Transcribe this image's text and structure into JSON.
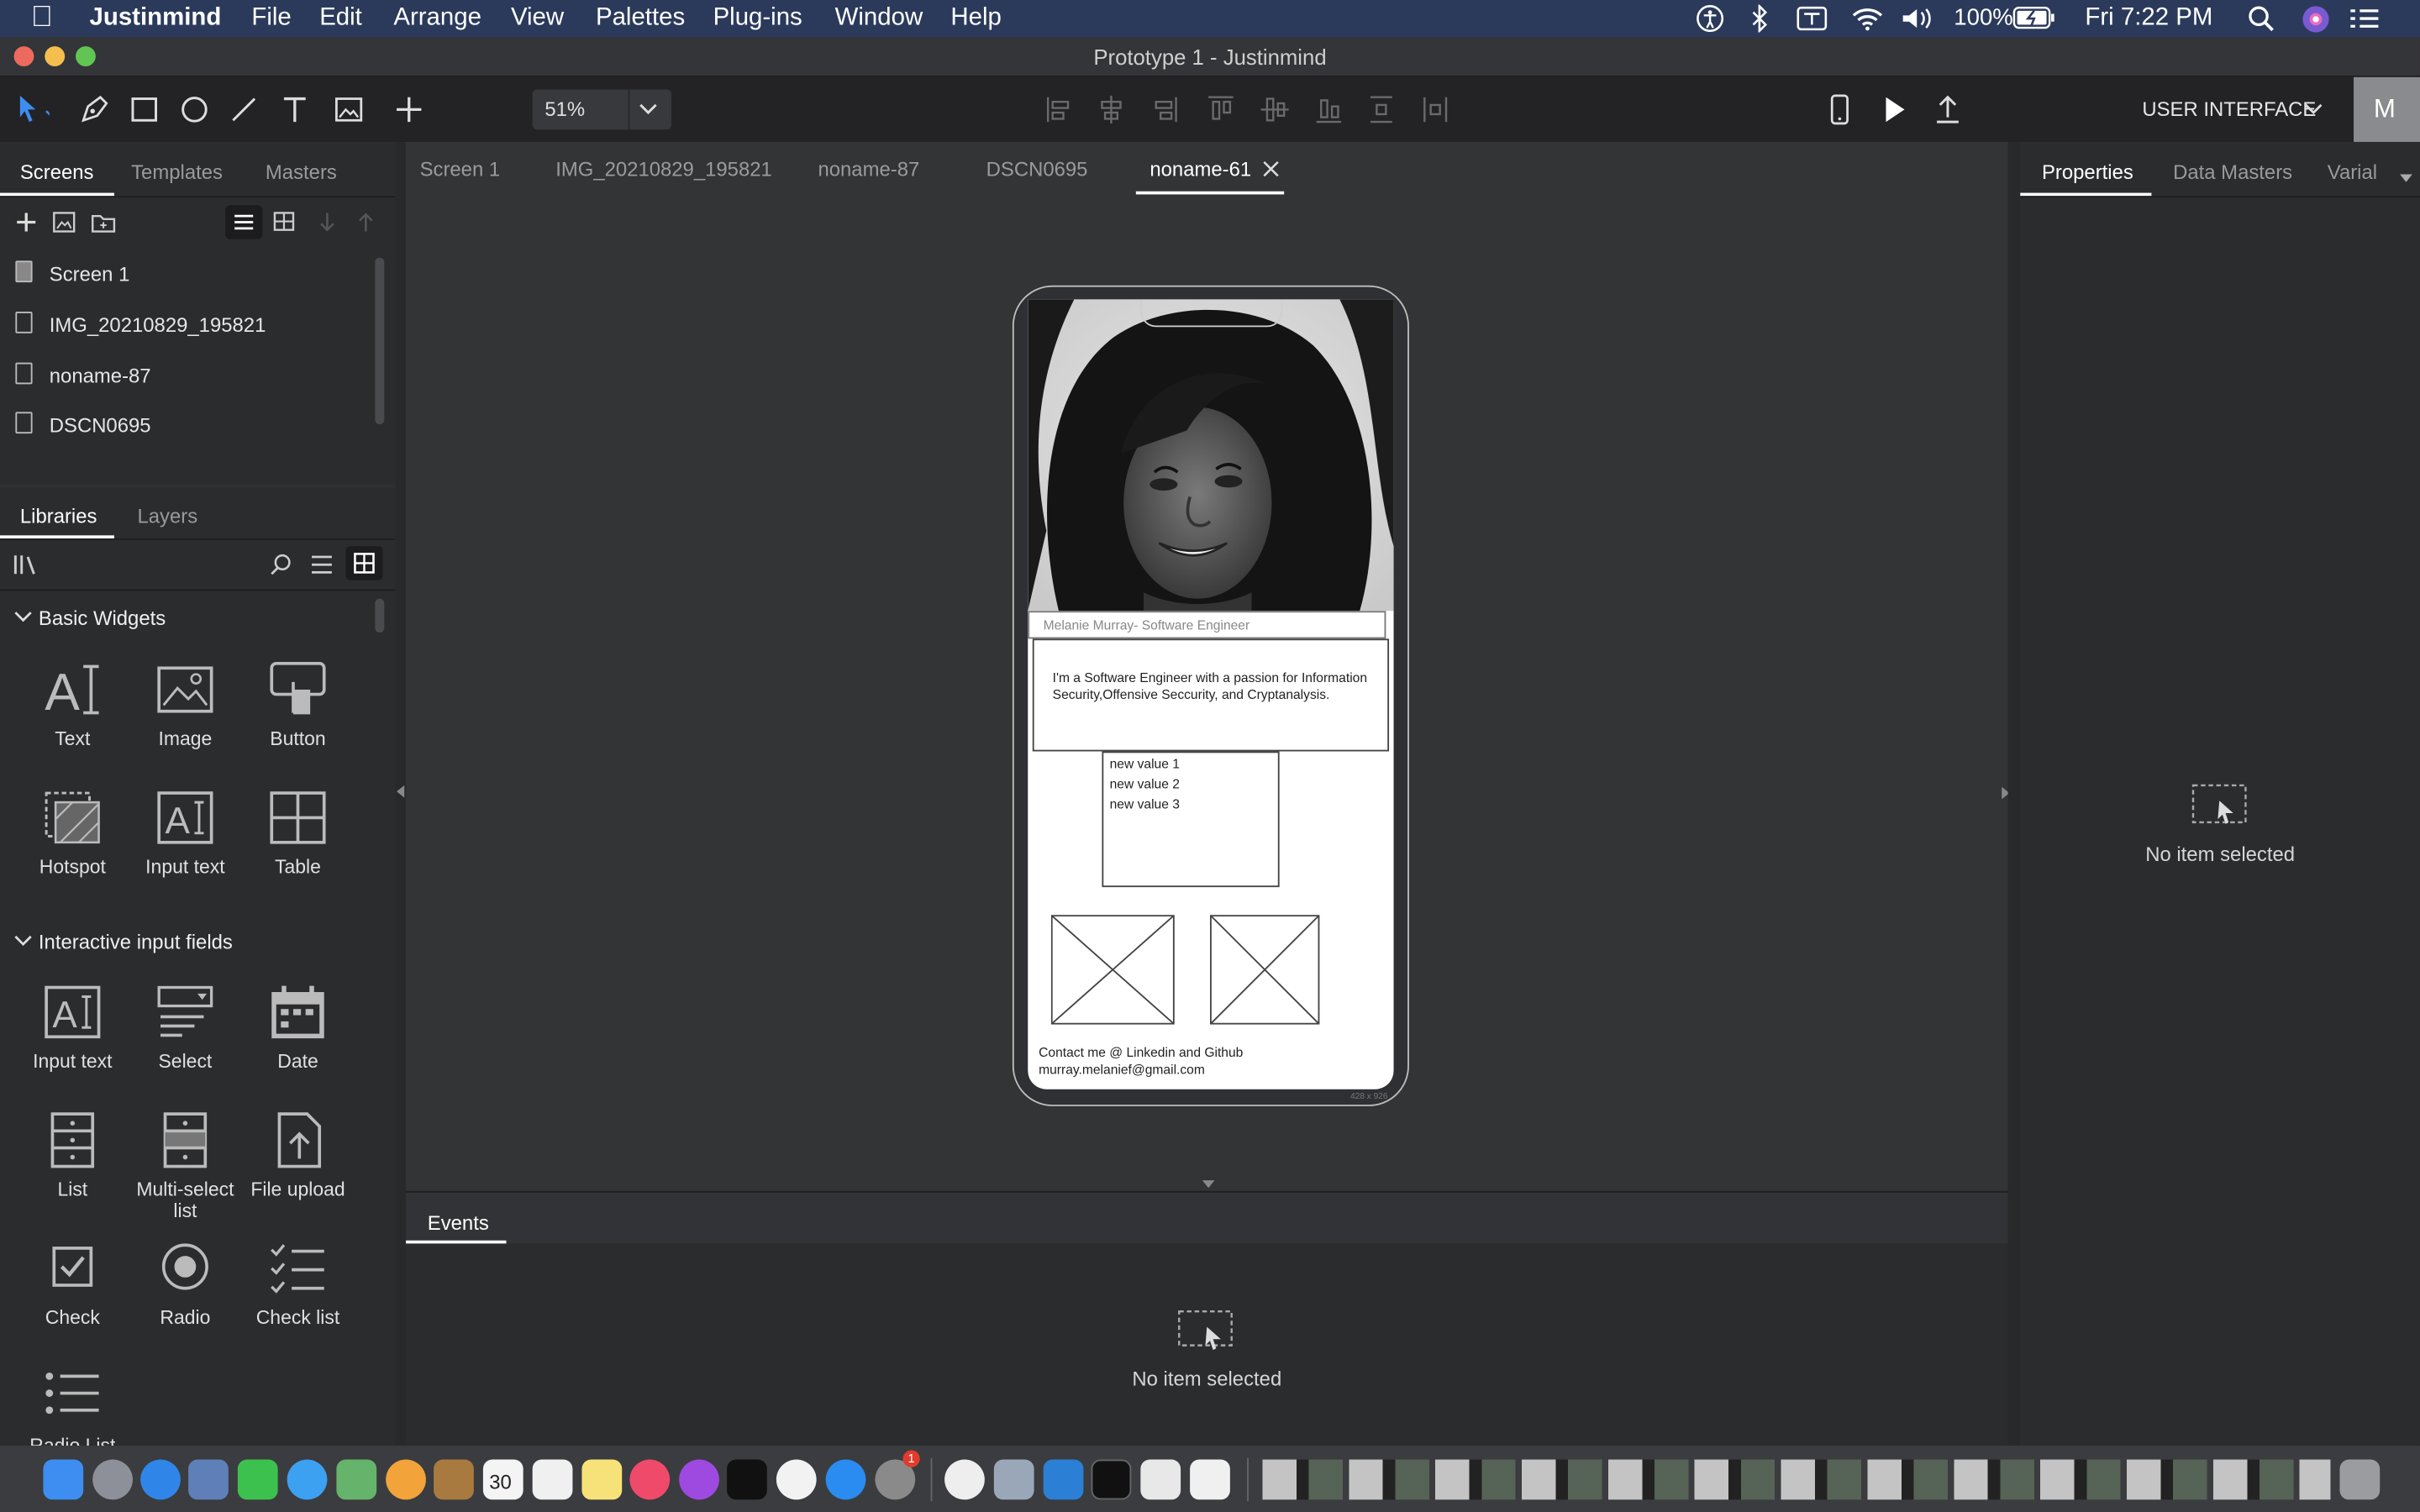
{
  "menubar": {
    "app_name": "Justinmind",
    "items": [
      "File",
      "Edit",
      "Arrange",
      "View",
      "Palettes",
      "Plug-ins",
      "Window",
      "Help"
    ],
    "battery": "100%",
    "clock": "Fri 7:22 PM"
  },
  "window": {
    "title": "Prototype 1 - Justinmind"
  },
  "toolbar": {
    "zoom": "51%",
    "mode": "USER INTERFACE",
    "avatar_letter": "M"
  },
  "screens_panel": {
    "tabs": [
      "Screens",
      "Templates",
      "Masters"
    ],
    "items": [
      "Screen 1",
      "IMG_20210829_195821",
      "noname-87",
      "DSCN0695"
    ]
  },
  "libraries_panel": {
    "tabs": [
      "Libraries",
      "Layers"
    ],
    "section_basic": "Basic Widgets",
    "basic_widgets": [
      "Text",
      "Image",
      "Button",
      "Hotspot",
      "Input text",
      "Table"
    ],
    "section_input": "Interactive input fields",
    "input_widgets": [
      "Input text",
      "Select",
      "Date",
      "List",
      "Multi-select list",
      "File upload",
      "Check",
      "Radio",
      "Check list",
      "Radio List"
    ]
  },
  "doc_tabs": [
    "Screen 1",
    "IMG_20210829_195821",
    "noname-87",
    "DSCN0695",
    "noname-61"
  ],
  "prototype": {
    "name_label": "Melanie Murray- Software Engineer",
    "bio": "I'm a Software Engineer with a passion for Information Security,Offensive Seccurity, and Cryptanalysis.",
    "list_values": [
      "new value 1",
      "new value 2",
      "new value 3"
    ],
    "contact_line1": "Contact me @ Linkedin and Github",
    "contact_line2": "murray.melanief@gmail.com",
    "size_label": "428 x 926"
  },
  "events_panel": {
    "tab": "Events",
    "empty": "No item selected"
  },
  "right_panel": {
    "tabs": [
      "Properties",
      "Data Masters",
      "Varial"
    ],
    "empty": "No item selected"
  },
  "dock": {
    "calendar_day": "30",
    "badge": "1"
  }
}
